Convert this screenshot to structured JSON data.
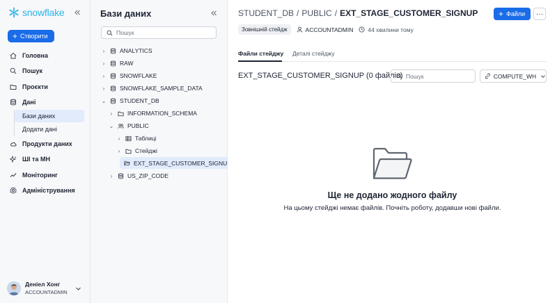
{
  "nav": {
    "logo_text": "snowflake",
    "create_label": "Створити",
    "items": [
      {
        "label": "Головна",
        "icon": "home-icon"
      },
      {
        "label": "Пошук",
        "icon": "search-icon"
      },
      {
        "label": "Проєкти",
        "icon": "folder-icon"
      },
      {
        "label": "Дані",
        "icon": "database-icon"
      },
      {
        "label": "Продукти даних",
        "icon": "cloud-icon"
      },
      {
        "label": "ШІ та МН",
        "icon": "sparkle-icon"
      },
      {
        "label": "Моніторинг",
        "icon": "activity-icon"
      },
      {
        "label": "Адміністрування",
        "icon": "gear-icon"
      }
    ],
    "sub_items": [
      {
        "label": "Бази даних",
        "active": true
      },
      {
        "label": "Додати дані",
        "active": false
      }
    ],
    "user": {
      "name": "Деніел Хонг",
      "role": "ACCOUNTADMIN"
    }
  },
  "tree": {
    "title": "Бази даних",
    "search_placeholder": "Пошук",
    "nodes": [
      {
        "label": "ANALYTICS",
        "type": "database",
        "expanded": false
      },
      {
        "label": "RAW",
        "type": "database",
        "expanded": false
      },
      {
        "label": "SNOWFLAKE",
        "type": "database",
        "expanded": false
      },
      {
        "label": "SNOWFLAKE_SAMPLE_DATA",
        "type": "database",
        "expanded": false
      },
      {
        "label": "STUDENT_DB",
        "type": "database",
        "expanded": true
      },
      {
        "label": "INFORMATION_SCHEMA",
        "type": "folder",
        "expanded": false
      },
      {
        "label": "PUBLIC",
        "type": "schema",
        "expanded": true
      },
      {
        "label": "Таблиці",
        "type": "table",
        "expanded": false
      },
      {
        "label": "Стейджі",
        "type": "folder",
        "expanded": true
      },
      {
        "label": "EXT_STAGE_CUSTOMER_SIGNUP",
        "type": "folder-open",
        "selected": true
      },
      {
        "label": "US_ZIP_CODE",
        "type": "database",
        "expanded": false
      }
    ]
  },
  "main": {
    "breadcrumb": [
      "STUDENT_DB",
      "/",
      "PUBLIC",
      "/",
      "EXT_STAGE_CUSTOMER_SIGNUP"
    ],
    "files_button": "Файли",
    "more_label": "···",
    "badge": "Зовнішній стейдж",
    "owner": "ACCOUNTADMIN",
    "updated": "44 хвилини тому",
    "tabs": [
      {
        "label": "Файли стейджу",
        "active": true
      },
      {
        "label": "Деталі стейджу",
        "active": false
      }
    ],
    "stage_heading": "EXT_STAGE_CUSTOMER_SIGNUP (0 файлів)",
    "search_placeholder": "Пошук",
    "warehouse": "COMPUTE_WH",
    "empty_title": "Ще не додано жодного файлу",
    "empty_subtitle": "На цьому стейджі немає файлів. Почніть роботу, додавши нові файли."
  },
  "colors": {
    "accent": "#1a6ce8",
    "brand": "#29b5e8",
    "selected_bg": "#e1ebfb"
  }
}
